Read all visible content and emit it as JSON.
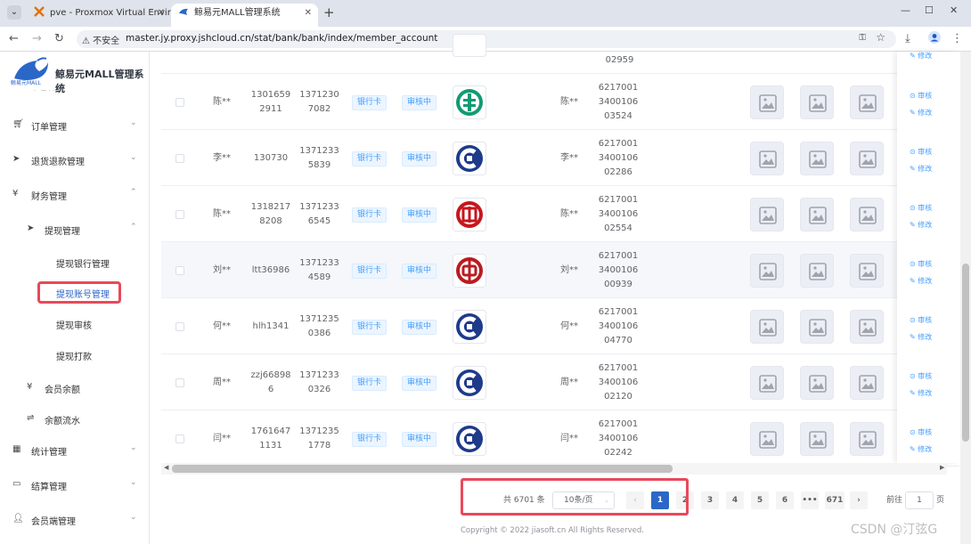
{
  "browser": {
    "tabs": [
      {
        "title": "pve - Proxmox Virtual Enviro",
        "active": false
      },
      {
        "title": "鲸易元MALL管理系统",
        "active": true
      }
    ],
    "security_label": "不安全",
    "url": "master.jy.proxy.jshcloud.cn/stat/bank/bank/index/member_account"
  },
  "app": {
    "title": "鲸易元MALL管理系统",
    "logo_caption": "鲸易元MALL"
  },
  "sidebar": {
    "items": [
      {
        "label": "订单管理",
        "icon": "cart-icon"
      },
      {
        "label": "退货退款管理",
        "icon": "send-icon"
      },
      {
        "label": "财务管理",
        "icon": "money-icon",
        "expanded": true
      },
      {
        "label": "提现管理",
        "icon": "send-icon",
        "expanded": true
      },
      {
        "label": "提现银行管理"
      },
      {
        "label": "提现账号管理",
        "active": true
      },
      {
        "label": "提现审核"
      },
      {
        "label": "提现打款"
      },
      {
        "label": "会员余额",
        "icon": "yen-icon"
      },
      {
        "label": "余额流水",
        "icon": "flow-icon"
      },
      {
        "label": "统计管理",
        "icon": "chart-icon"
      },
      {
        "label": "结算管理",
        "icon": "monitor-icon"
      },
      {
        "label": "会员端管理",
        "icon": "user-icon"
      }
    ]
  },
  "table": {
    "top_partial": {
      "card_tail": "02959"
    },
    "rows": [
      {
        "name": "陈**",
        "account": [
          "1301659",
          "2911"
        ],
        "phone": [
          "1371230",
          "7082"
        ],
        "type": "银行卡",
        "status": "审核中",
        "bank": "abc",
        "holder": "陈**",
        "card": [
          "6217001",
          "3400106",
          "03524"
        ]
      },
      {
        "name": "李**",
        "account": [
          "130730"
        ],
        "phone": [
          "1371233",
          "5839"
        ],
        "type": "银行卡",
        "status": "审核中",
        "bank": "ccb",
        "holder": "李**",
        "card": [
          "6217001",
          "3400106",
          "02286"
        ]
      },
      {
        "name": "陈**",
        "account": [
          "1318217",
          "8208"
        ],
        "phone": [
          "1371233",
          "6545"
        ],
        "type": "银行卡",
        "status": "审核中",
        "bank": "icbc",
        "holder": "陈**",
        "card": [
          "6217001",
          "3400106",
          "02554"
        ]
      },
      {
        "name": "刘**",
        "account": [
          "ltt36986"
        ],
        "phone": [
          "1371233",
          "4589"
        ],
        "type": "银行卡",
        "status": "审核中",
        "bank": "boc",
        "holder": "刘**",
        "card": [
          "6217001",
          "3400106",
          "00939"
        ]
      },
      {
        "name": "何**",
        "account": [
          "hlh1341"
        ],
        "phone": [
          "1371235",
          "0386"
        ],
        "type": "银行卡",
        "status": "审核中",
        "bank": "ccb",
        "holder": "何**",
        "card": [
          "6217001",
          "3400106",
          "04770"
        ]
      },
      {
        "name": "周**",
        "account": [
          "zzj66898",
          "6"
        ],
        "phone": [
          "1371233",
          "0326"
        ],
        "type": "银行卡",
        "status": "审核中",
        "bank": "ccb",
        "holder": "周**",
        "card": [
          "6217001",
          "3400106",
          "02120"
        ]
      },
      {
        "name": "闫**",
        "account": [
          "1761647",
          "1131"
        ],
        "phone": [
          "1371235",
          "1778"
        ],
        "type": "银行卡",
        "status": "审核中",
        "bank": "ccb",
        "holder": "闫**",
        "card": [
          "6217001",
          "3400106",
          "02242"
        ]
      }
    ],
    "actions": {
      "review": "审核",
      "edit": "修改"
    }
  },
  "pagination": {
    "total": "共 6701 条",
    "page_size": "10条/页",
    "pages": [
      "1",
      "2",
      "3",
      "4",
      "5",
      "6",
      "•••",
      "671"
    ],
    "current": "1",
    "goto_label": "前往",
    "goto_value": "1",
    "goto_unit": "页"
  },
  "footer": "Copyright © 2022 jiasoft.cn All Rights Reserved.",
  "watermark": "CSDN @汀弦G",
  "colors": {
    "brand": "#2b67c7",
    "highlight": "#e8495a",
    "tag": "#409eff"
  }
}
